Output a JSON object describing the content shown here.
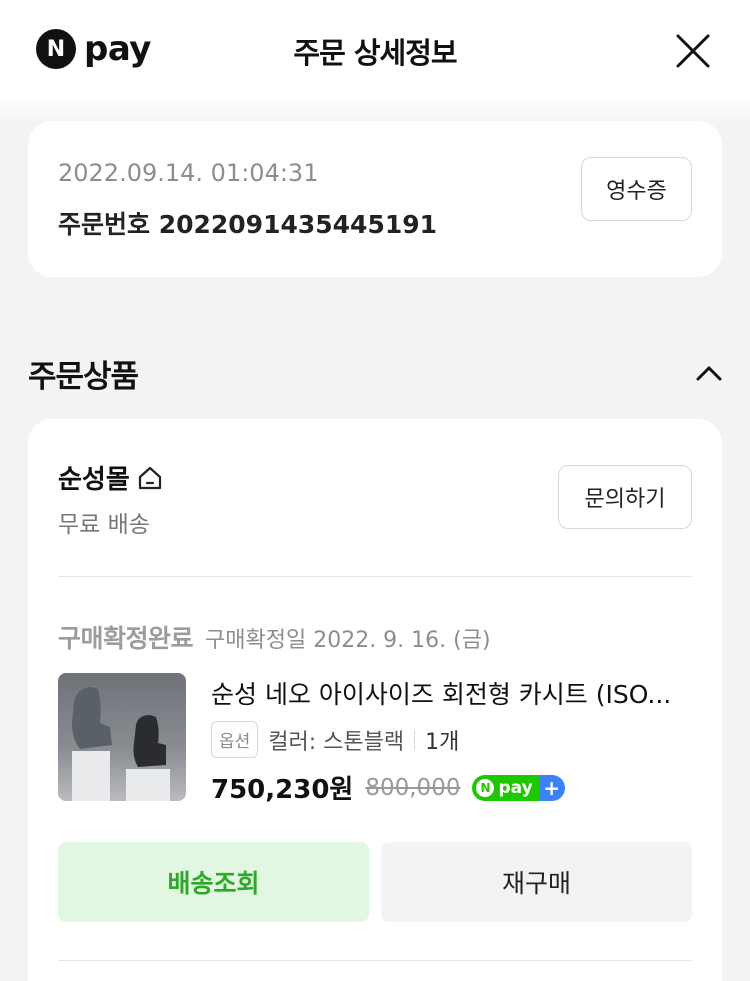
{
  "header": {
    "logo_letter": "N",
    "logo_text": "pay",
    "title": "주문 상세정보"
  },
  "order": {
    "datetime": "2022.09.14. 01:04:31",
    "number_label": "주문번호 2022091435445191",
    "receipt_button": "영수증"
  },
  "section": {
    "title": "주문상품"
  },
  "seller": {
    "name": "순성몰",
    "shipping": "무료 배송",
    "inquiry_button": "문의하기"
  },
  "product": {
    "status": "구매확정완료",
    "status_date": "구매확정일 2022. 9. 16. (금)",
    "name": "순성 네오 아이사이즈 회전형 카시트 (ISO...",
    "option_tag": "옵션",
    "option_value": "컬러: 스톤블랙",
    "quantity": "1개",
    "price": "750,230원",
    "original_price": "800,000",
    "npay_badge_text": "pay",
    "npay_badge_plus": "+"
  },
  "actions": {
    "track_button": "배송조회",
    "rebuy_button": "재구매"
  },
  "colors": {
    "accent_green": "#2ea82b",
    "npay_green": "#1ec800",
    "npay_blue": "#3b82f6"
  }
}
